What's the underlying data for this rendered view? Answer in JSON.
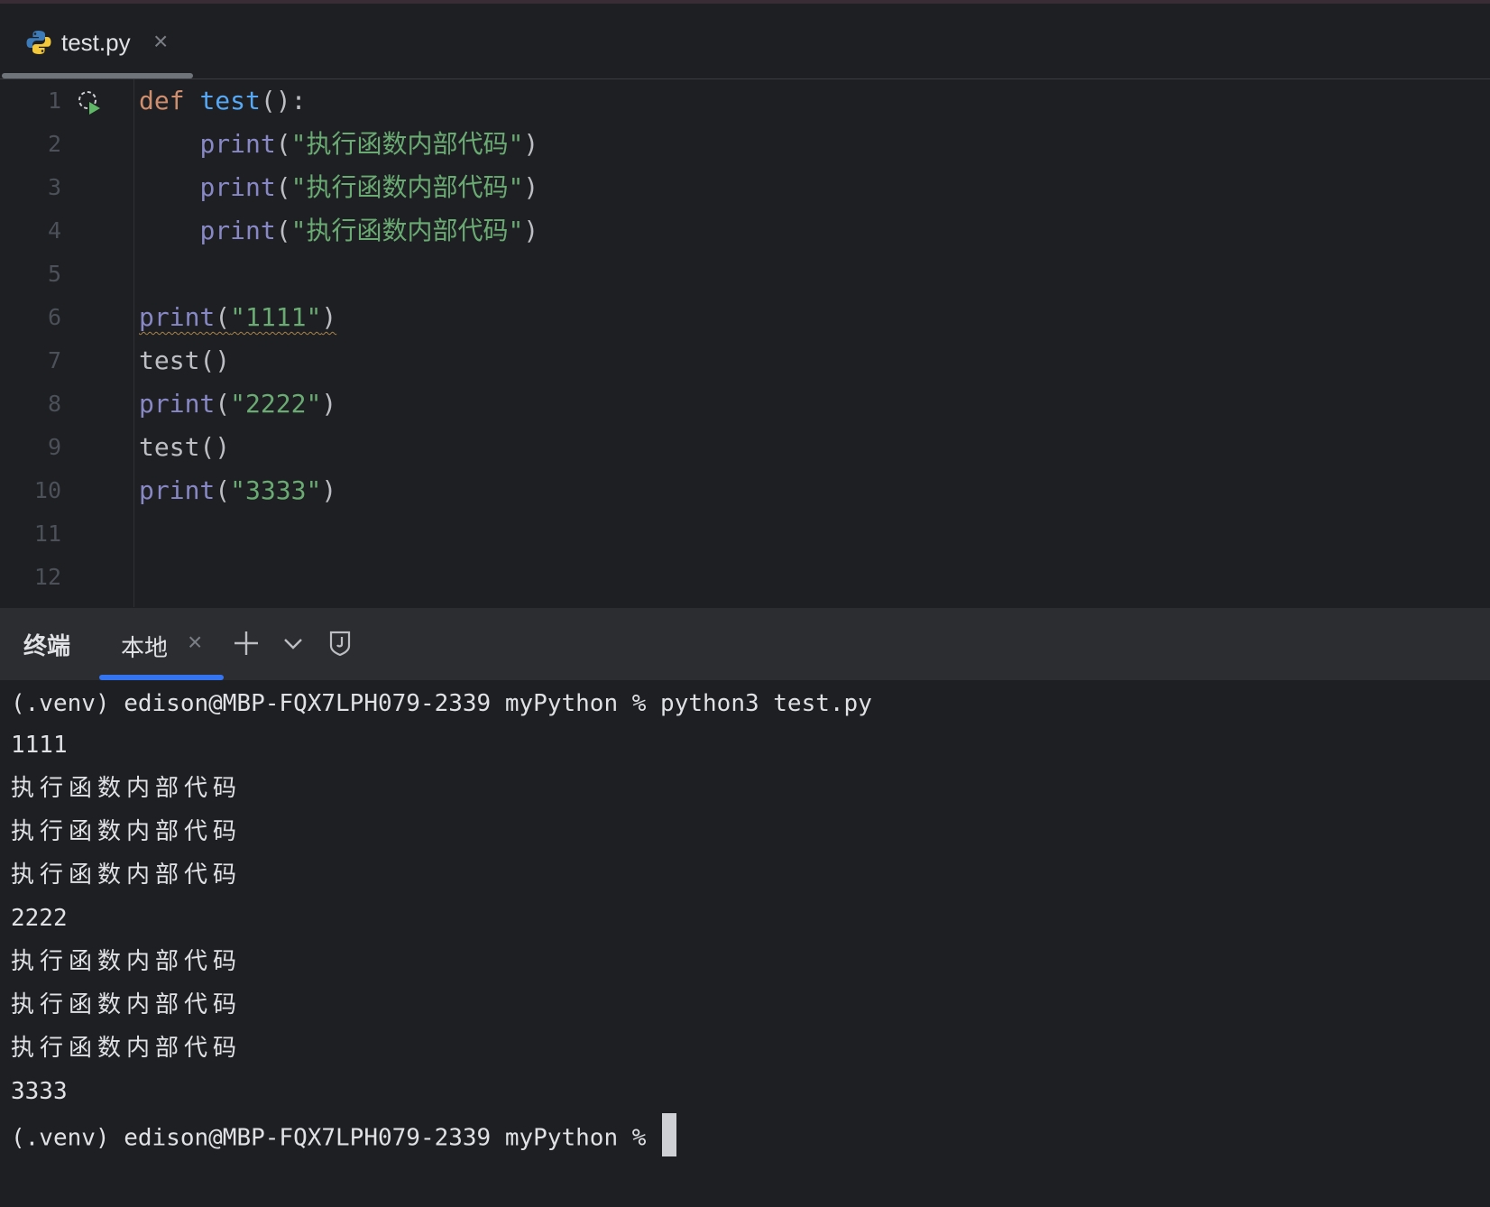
{
  "editor_tab": {
    "label": "test.py",
    "close": "×"
  },
  "code_lines": [
    {
      "n": "1",
      "tokens": [
        {
          "t": "def ",
          "c": "kw"
        },
        {
          "t": "test",
          "c": "fn"
        },
        {
          "t": "():",
          "c": "plain"
        }
      ]
    },
    {
      "n": "2",
      "tokens": [
        {
          "t": "    ",
          "c": "plain"
        },
        {
          "t": "print",
          "c": "bi"
        },
        {
          "t": "(",
          "c": "plain"
        },
        {
          "t": "\"执行函数内部代码\"",
          "c": "str"
        },
        {
          "t": ")",
          "c": "plain"
        }
      ]
    },
    {
      "n": "3",
      "tokens": [
        {
          "t": "    ",
          "c": "plain"
        },
        {
          "t": "print",
          "c": "bi"
        },
        {
          "t": "(",
          "c": "plain"
        },
        {
          "t": "\"执行函数内部代码\"",
          "c": "str"
        },
        {
          "t": ")",
          "c": "plain"
        }
      ]
    },
    {
      "n": "4",
      "tokens": [
        {
          "t": "    ",
          "c": "plain"
        },
        {
          "t": "print",
          "c": "bi"
        },
        {
          "t": "(",
          "c": "plain"
        },
        {
          "t": "\"执行函数内部代码\"",
          "c": "str"
        },
        {
          "t": ")",
          "c": "plain"
        }
      ]
    },
    {
      "n": "5",
      "tokens": []
    },
    {
      "n": "6",
      "tokens": [
        {
          "t": "print",
          "c": "bi"
        },
        {
          "t": "(",
          "c": "plain"
        },
        {
          "t": "\"1111\"",
          "c": "str"
        },
        {
          "t": ")",
          "c": "plain"
        }
      ],
      "squiggle": true
    },
    {
      "n": "7",
      "tokens": [
        {
          "t": "test()",
          "c": "plain"
        }
      ]
    },
    {
      "n": "8",
      "tokens": [
        {
          "t": "print",
          "c": "bi"
        },
        {
          "t": "(",
          "c": "plain"
        },
        {
          "t": "\"2222\"",
          "c": "str"
        },
        {
          "t": ")",
          "c": "plain"
        }
      ]
    },
    {
      "n": "9",
      "tokens": [
        {
          "t": "test()",
          "c": "plain"
        }
      ]
    },
    {
      "n": "10",
      "tokens": [
        {
          "t": "print",
          "c": "bi"
        },
        {
          "t": "(",
          "c": "plain"
        },
        {
          "t": "\"3333\"",
          "c": "str"
        },
        {
          "t": ")",
          "c": "plain"
        }
      ]
    },
    {
      "n": "11",
      "tokens": []
    },
    {
      "n": "12",
      "tokens": []
    }
  ],
  "terminal": {
    "title": "终端",
    "tab_label": "本地",
    "tab_close": "×",
    "lines": [
      "(.venv) edison@MBP-FQX7LPH079-2339 myPython % python3 test.py",
      "1111",
      "执行函数内部代码",
      "执行函数内部代码",
      "执行函数内部代码",
      "2222",
      "执行函数内部代码",
      "执行函数内部代码",
      "执行函数内部代码",
      "3333",
      "(.venv) edison@MBP-FQX7LPH079-2339 myPython % "
    ]
  },
  "colors": {
    "keyword": "#cf8e6d",
    "function": "#56a8f5",
    "builtin": "#8888c6",
    "string": "#6aab73",
    "accent": "#3574f0"
  }
}
